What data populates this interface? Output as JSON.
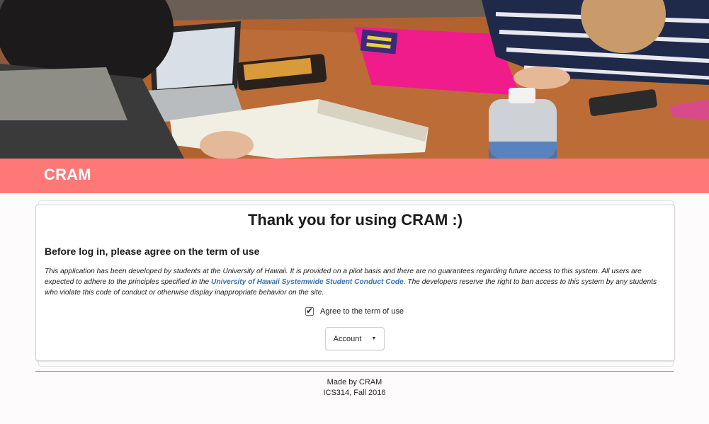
{
  "header": {
    "brand": "CRAM",
    "brand_color": "#fe7878"
  },
  "hero": {
    "description_icon": "students-studying-photo"
  },
  "card": {
    "title": "Thank you for using CRAM :)",
    "subtitle": "Before log in, please agree on the term of use",
    "text_before_link": "This application has been developed by students at the University of Hawaii. It is provided on a pilot basis and there are no guarantees regarding future access to this system. All users are expected to adhere to the principles specified in the ",
    "link_text": "University of Hawaii Systemwide Student Conduct Code",
    "text_after_link": ". The developers reserve the right to ban access to this system by any students who violate this code of conduct or otherwise display inappropriate behavior on the site.",
    "link_color": "#3a6fb0",
    "agree_label": "Agree to the term of use",
    "agree_checked": true,
    "account_button": "Account",
    "account_icon": "caret-down-icon"
  },
  "footer": {
    "line1": "Made by CRAM",
    "line2": "ICS314, Fall 2016"
  }
}
